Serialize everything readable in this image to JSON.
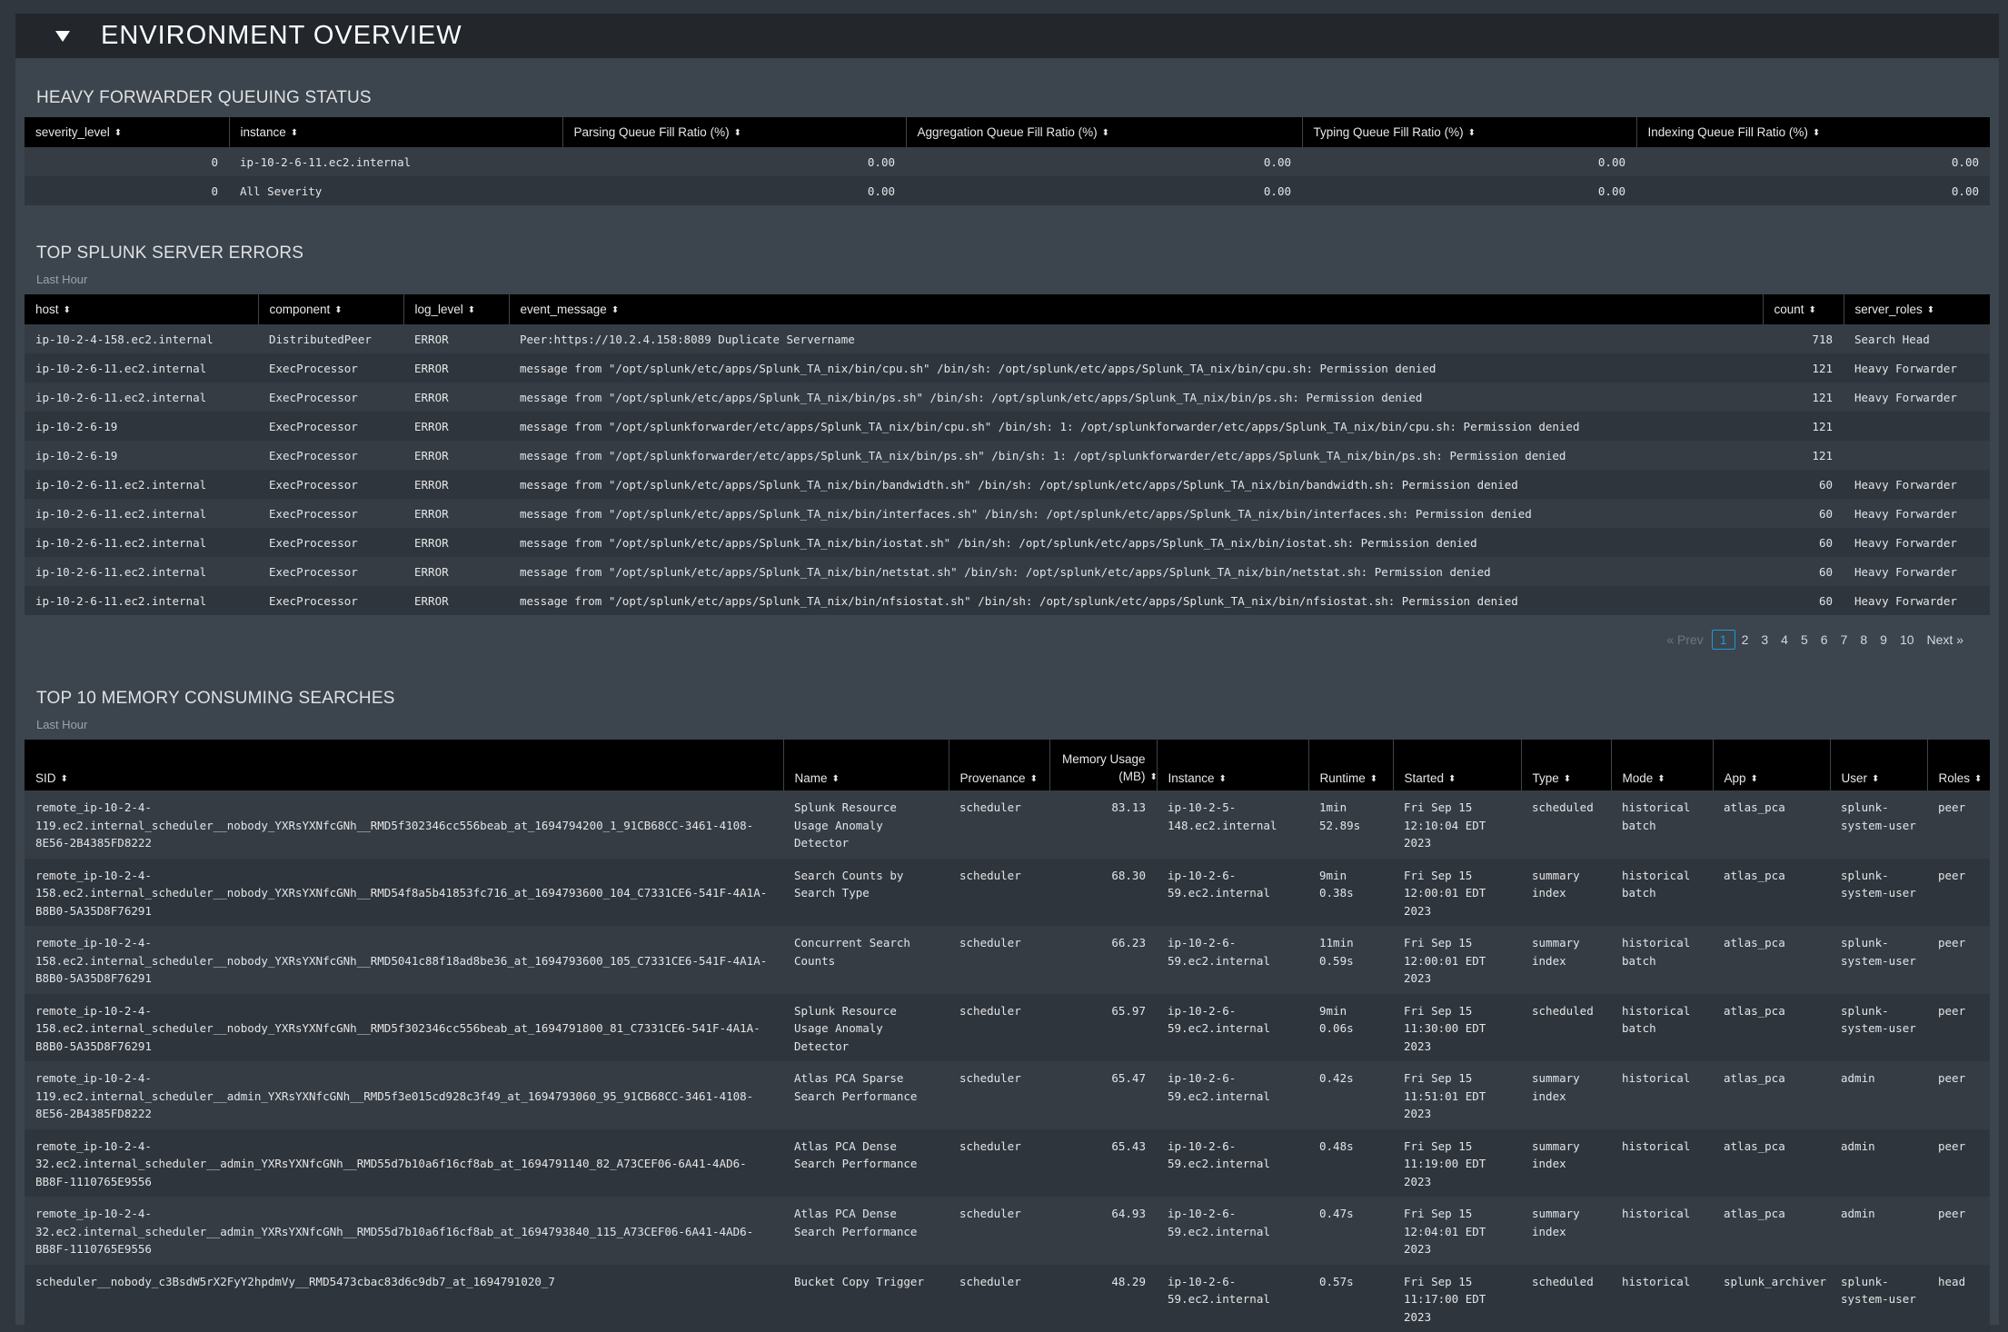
{
  "dashboard": {
    "row_title": "ENVIRONMENT OVERVIEW"
  },
  "hf_queue": {
    "title": "HEAVY FORWARDER QUEUING STATUS",
    "columns": [
      "severity_level",
      "instance",
      "Parsing Queue Fill Ratio (%)",
      "Aggregation Queue Fill Ratio (%)",
      "Typing Queue Fill Ratio (%)",
      "Indexing Queue Fill Ratio (%)"
    ],
    "rows": [
      [
        "0",
        "ip-10-2-6-11.ec2.internal",
        "0.00",
        "0.00",
        "0.00",
        "0.00"
      ],
      [
        "0",
        "All Severity",
        "0.00",
        "0.00",
        "0.00",
        "0.00"
      ]
    ]
  },
  "errors": {
    "title": "TOP SPLUNK SERVER ERRORS",
    "subtitle": "Last Hour",
    "columns": [
      "host",
      "component",
      "log_level",
      "event_message",
      "count",
      "server_roles"
    ],
    "rows": [
      [
        "ip-10-2-4-158.ec2.internal",
        "DistributedPeer",
        "ERROR",
        "Peer:https://10.2.4.158:8089 Duplicate Servername",
        "718",
        "Search Head"
      ],
      [
        "ip-10-2-6-11.ec2.internal",
        "ExecProcessor",
        "ERROR",
        "message from \"/opt/splunk/etc/apps/Splunk_TA_nix/bin/cpu.sh\" /bin/sh: /opt/splunk/etc/apps/Splunk_TA_nix/bin/cpu.sh: Permission denied",
        "121",
        "Heavy Forwarder"
      ],
      [
        "ip-10-2-6-11.ec2.internal",
        "ExecProcessor",
        "ERROR",
        "message from \"/opt/splunk/etc/apps/Splunk_TA_nix/bin/ps.sh\" /bin/sh: /opt/splunk/etc/apps/Splunk_TA_nix/bin/ps.sh: Permission denied",
        "121",
        "Heavy Forwarder"
      ],
      [
        "ip-10-2-6-19",
        "ExecProcessor",
        "ERROR",
        "message from \"/opt/splunkforwarder/etc/apps/Splunk_TA_nix/bin/cpu.sh\" /bin/sh: 1: /opt/splunkforwarder/etc/apps/Splunk_TA_nix/bin/cpu.sh: Permission denied",
        "121",
        ""
      ],
      [
        "ip-10-2-6-19",
        "ExecProcessor",
        "ERROR",
        "message from \"/opt/splunkforwarder/etc/apps/Splunk_TA_nix/bin/ps.sh\" /bin/sh: 1: /opt/splunkforwarder/etc/apps/Splunk_TA_nix/bin/ps.sh: Permission denied",
        "121",
        ""
      ],
      [
        "ip-10-2-6-11.ec2.internal",
        "ExecProcessor",
        "ERROR",
        "message from \"/opt/splunk/etc/apps/Splunk_TA_nix/bin/bandwidth.sh\" /bin/sh: /opt/splunk/etc/apps/Splunk_TA_nix/bin/bandwidth.sh: Permission denied",
        "60",
        "Heavy Forwarder"
      ],
      [
        "ip-10-2-6-11.ec2.internal",
        "ExecProcessor",
        "ERROR",
        "message from \"/opt/splunk/etc/apps/Splunk_TA_nix/bin/interfaces.sh\" /bin/sh: /opt/splunk/etc/apps/Splunk_TA_nix/bin/interfaces.sh: Permission denied",
        "60",
        "Heavy Forwarder"
      ],
      [
        "ip-10-2-6-11.ec2.internal",
        "ExecProcessor",
        "ERROR",
        "message from \"/opt/splunk/etc/apps/Splunk_TA_nix/bin/iostat.sh\" /bin/sh: /opt/splunk/etc/apps/Splunk_TA_nix/bin/iostat.sh: Permission denied",
        "60",
        "Heavy Forwarder"
      ],
      [
        "ip-10-2-6-11.ec2.internal",
        "ExecProcessor",
        "ERROR",
        "message from \"/opt/splunk/etc/apps/Splunk_TA_nix/bin/netstat.sh\" /bin/sh: /opt/splunk/etc/apps/Splunk_TA_nix/bin/netstat.sh: Permission denied",
        "60",
        "Heavy Forwarder"
      ],
      [
        "ip-10-2-6-11.ec2.internal",
        "ExecProcessor",
        "ERROR",
        "message from \"/opt/splunk/etc/apps/Splunk_TA_nix/bin/nfsiostat.sh\" /bin/sh: /opt/splunk/etc/apps/Splunk_TA_nix/bin/nfsiostat.sh: Permission denied",
        "60",
        "Heavy Forwarder"
      ]
    ],
    "pagination": {
      "prev": "« Prev",
      "pages": [
        "1",
        "2",
        "3",
        "4",
        "5",
        "6",
        "7",
        "8",
        "9",
        "10"
      ],
      "active": "1",
      "next": "Next »"
    }
  },
  "memory": {
    "title": "TOP 10 MEMORY CONSUMING SEARCHES",
    "subtitle": "Last Hour",
    "columns": [
      "SID",
      "Name",
      "Provenance",
      "Memory Usage (MB)",
      "Instance",
      "Runtime",
      "Started",
      "Type",
      "Mode",
      "App",
      "User",
      "Roles"
    ],
    "rows": [
      [
        "remote_ip-10-2-4-119.ec2.internal_scheduler__nobody_YXRsYXNfcGNh__RMD5f302346cc556beab_at_1694794200_1_91CB68CC-3461-4108-8E56-2B4385FD8222",
        "Splunk Resource Usage Anomaly Detector",
        "scheduler",
        "83.13",
        "ip-10-2-5-148.ec2.internal",
        "1min 52.89s",
        "Fri Sep 15 12:10:04 EDT 2023",
        "scheduled",
        "historical batch",
        "atlas_pca",
        "splunk-system-user",
        "peer"
      ],
      [
        "remote_ip-10-2-4-158.ec2.internal_scheduler__nobody_YXRsYXNfcGNh__RMD54f8a5b41853fc716_at_1694793600_104_C7331CE6-541F-4A1A-B8B0-5A35D8F76291",
        "Search Counts by Search Type",
        "scheduler",
        "68.30",
        "ip-10-2-6-59.ec2.internal",
        "9min 0.38s",
        "Fri Sep 15 12:00:01 EDT 2023",
        "summary index",
        "historical batch",
        "atlas_pca",
        "splunk-system-user",
        "peer"
      ],
      [
        "remote_ip-10-2-4-158.ec2.internal_scheduler__nobody_YXRsYXNfcGNh__RMD5041c88f18ad8be36_at_1694793600_105_C7331CE6-541F-4A1A-B8B0-5A35D8F76291",
        "Concurrent Search Counts",
        "scheduler",
        "66.23",
        "ip-10-2-6-59.ec2.internal",
        "11min 0.59s",
        "Fri Sep 15 12:00:01 EDT 2023",
        "summary index",
        "historical batch",
        "atlas_pca",
        "splunk-system-user",
        "peer"
      ],
      [
        "remote_ip-10-2-4-158.ec2.internal_scheduler__nobody_YXRsYXNfcGNh__RMD5f302346cc556beab_at_1694791800_81_C7331CE6-541F-4A1A-B8B0-5A35D8F76291",
        "Splunk Resource Usage Anomaly Detector",
        "scheduler",
        "65.97",
        "ip-10-2-6-59.ec2.internal",
        "9min 0.06s",
        "Fri Sep 15 11:30:00 EDT 2023",
        "scheduled",
        "historical batch",
        "atlas_pca",
        "splunk-system-user",
        "peer"
      ],
      [
        "remote_ip-10-2-4-119.ec2.internal_scheduler__admin_YXRsYXNfcGNh__RMD5f3e015cd928c3f49_at_1694793060_95_91CB68CC-3461-4108-8E56-2B4385FD8222",
        "Atlas PCA Sparse Search Performance",
        "scheduler",
        "65.47",
        "ip-10-2-6-59.ec2.internal",
        "0.42s",
        "Fri Sep 15 11:51:01 EDT 2023",
        "summary index",
        "historical",
        "atlas_pca",
        "admin",
        "peer"
      ],
      [
        "remote_ip-10-2-4-32.ec2.internal_scheduler__admin_YXRsYXNfcGNh__RMD55d7b10a6f16cf8ab_at_1694791140_82_A73CEF06-6A41-4AD6-BB8F-1110765E9556",
        "Atlas PCA Dense Search Performance",
        "scheduler",
        "65.43",
        "ip-10-2-6-59.ec2.internal",
        "0.48s",
        "Fri Sep 15 11:19:00 EDT 2023",
        "summary index",
        "historical",
        "atlas_pca",
        "admin",
        "peer"
      ],
      [
        "remote_ip-10-2-4-32.ec2.internal_scheduler__admin_YXRsYXNfcGNh__RMD55d7b10a6f16cf8ab_at_1694793840_115_A73CEF06-6A41-4AD6-BB8F-1110765E9556",
        "Atlas PCA Dense Search Performance",
        "scheduler",
        "64.93",
        "ip-10-2-6-59.ec2.internal",
        "0.47s",
        "Fri Sep 15 12:04:01 EDT 2023",
        "summary index",
        "historical",
        "atlas_pca",
        "admin",
        "peer"
      ],
      [
        "scheduler__nobody_c3BsdW5rX2FyY2hpdmVy__RMD5473cbac83d6c9db7_at_1694791020_7",
        "Bucket Copy Trigger",
        "scheduler",
        "48.29",
        "ip-10-2-6-59.ec2.internal",
        "0.57s",
        "Fri Sep 15 11:17:00 EDT 2023",
        "scheduled",
        "historical",
        "splunk_archiver",
        "splunk-system-user",
        "head"
      ]
    ]
  },
  "colors": {
    "page_bg": "#31373e",
    "panel_bg": "#3c444d",
    "header_bg": "#000000",
    "active_page": "#1a9cd9"
  },
  "icons": {
    "collapse": "caret-down-icon",
    "sort": "sort-icon"
  }
}
